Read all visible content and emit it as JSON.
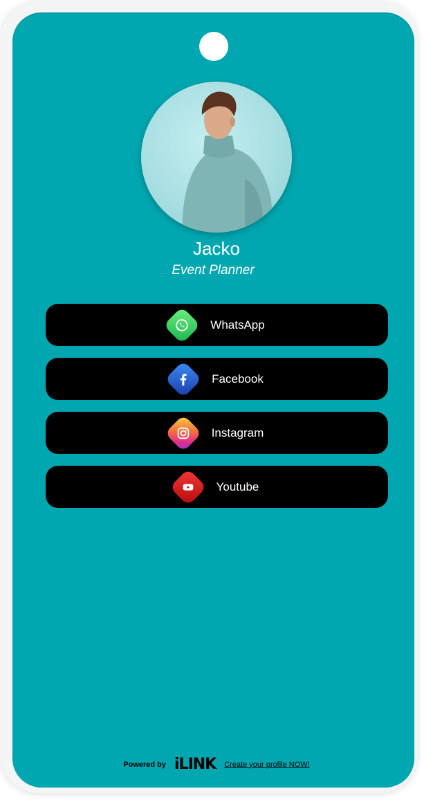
{
  "profile": {
    "name": "Jacko",
    "role": "Event Planner"
  },
  "links": [
    {
      "label": "WhatsApp",
      "icon": "whatsapp-icon"
    },
    {
      "label": "Facebook",
      "icon": "facebook-icon"
    },
    {
      "label": "Instagram",
      "icon": "instagram-icon"
    },
    {
      "label": "Youtube",
      "icon": "youtube-icon"
    }
  ],
  "footer": {
    "powered_by": "Powered by",
    "brand": "iLINK",
    "cta": "Create your profile NOW!"
  },
  "colors": {
    "card_background": "#00a7b0",
    "button_background": "#000000",
    "text": "#ffffff"
  }
}
